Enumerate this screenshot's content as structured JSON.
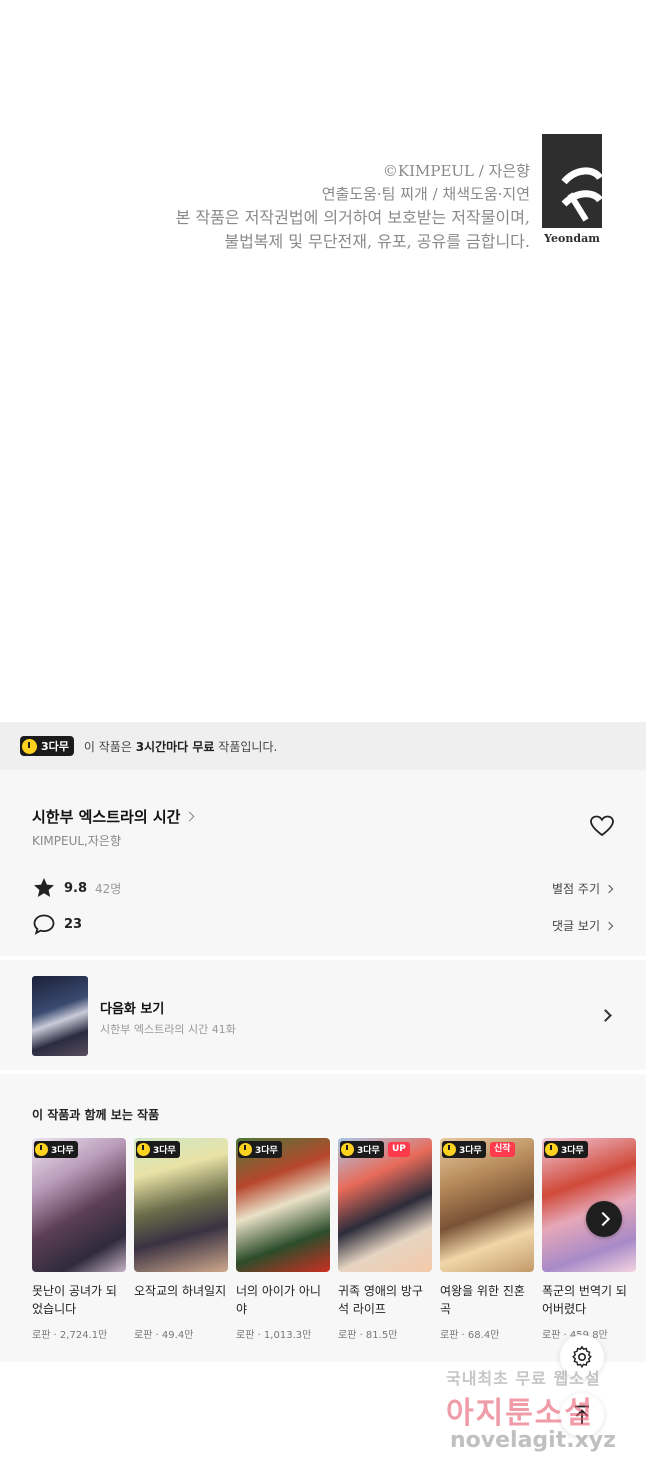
{
  "credit": {
    "line1": "©KIMPEUL / 자은향",
    "line2": "연출도움·팀 찌개 / 채색도움·지연",
    "line3": "본 작품은 저작권법에 의거하여 보호받는 저작물이며,",
    "line4": "불법복제 및 무단전재, 유포, 공유를 금합니다.",
    "publisher": "Yeondam"
  },
  "free_banner": {
    "badge": "3다무",
    "text_prefix": "이 작품은 ",
    "text_bold": "3시간마다 무료",
    "text_suffix": " 작품입니다."
  },
  "work": {
    "title": "시한부 엑스트라의 시간",
    "authors": "KIMPEUL,자은향",
    "rating": "9.8",
    "rating_count": "42명",
    "rate_link": "별점 주기",
    "comments": "23",
    "comment_link": "댓글 보기"
  },
  "next_episode": {
    "title": "다음화 보기",
    "subtitle": "시한부 엑스트라의 시간 41화"
  },
  "recommendations": {
    "heading": "이 작품과 함께 보는 작품",
    "badge": "3다무",
    "items": [
      {
        "title": "못난이 공녀가 되었습니다",
        "meta": "로판 · 2,724.1만",
        "tag": ""
      },
      {
        "title": "오작교의 하녀일지",
        "meta": "로판 · 49.4만",
        "tag": ""
      },
      {
        "title": "너의 아이가 아니야",
        "meta": "로판 · 1,013.3만",
        "tag": ""
      },
      {
        "title": "귀족 영애의 방구석 라이프",
        "meta": "로판 · 81.5만",
        "tag": "UP"
      },
      {
        "title": "여왕을 위한 진혼곡",
        "meta": "로판 · 68.4만",
        "tag": "신작"
      },
      {
        "title": "폭군의 번역기 되어버렸다",
        "meta": "로판 · 459.8만",
        "tag": ""
      }
    ]
  },
  "watermark": {
    "line1": "국내최초 무료 웹소설",
    "line2": "아지툰소설",
    "line3": "novelagit.xyz"
  }
}
